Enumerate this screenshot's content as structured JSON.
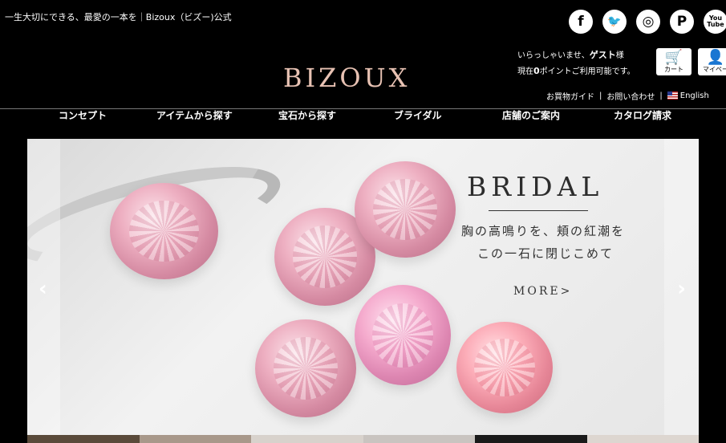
{
  "header": {
    "tagline": "一生大切にできる、最愛の一本を｜Bizoux（ビズー)公式",
    "logo": "BIZOUX",
    "welcome_prefix": "いらっしゃいませ、",
    "guest_name": "ゲスト",
    "guest_suffix": "様",
    "points_prefix": "現在",
    "points_value": "0",
    "points_suffix": "ポイントご利用可能です。",
    "cart_label": "カート",
    "mypage_label": "マイペー",
    "guide_link": "お買物ガイド",
    "contact_link": "お問い合わせ",
    "separator": "|",
    "english_link": "English"
  },
  "social": [
    {
      "icon": "facebook-icon",
      "glyph": "f"
    },
    {
      "icon": "twitter-icon",
      "glyph": "🐦"
    },
    {
      "icon": "instagram-icon",
      "glyph": "◎"
    },
    {
      "icon": "pinterest-icon",
      "glyph": "P"
    },
    {
      "icon": "youtube-icon",
      "glyph": "You Tube"
    }
  ],
  "nav": {
    "items": [
      "コンセプト",
      "アイテムから探す",
      "宝石から探す",
      "ブライダル",
      "店舗のご案内",
      "カタログ請求"
    ]
  },
  "slider": {
    "title": "BRIDAL",
    "line1": "胸の高鳴りを、頬の紅潮を",
    "line2": "この一石に閉じこめて",
    "more": "MORE>",
    "prev_arrow": "‹",
    "next_arrow": "›"
  },
  "colors": {
    "background": "#000000",
    "logo": "#e8c2b3",
    "gem": "#eeb0c2"
  }
}
